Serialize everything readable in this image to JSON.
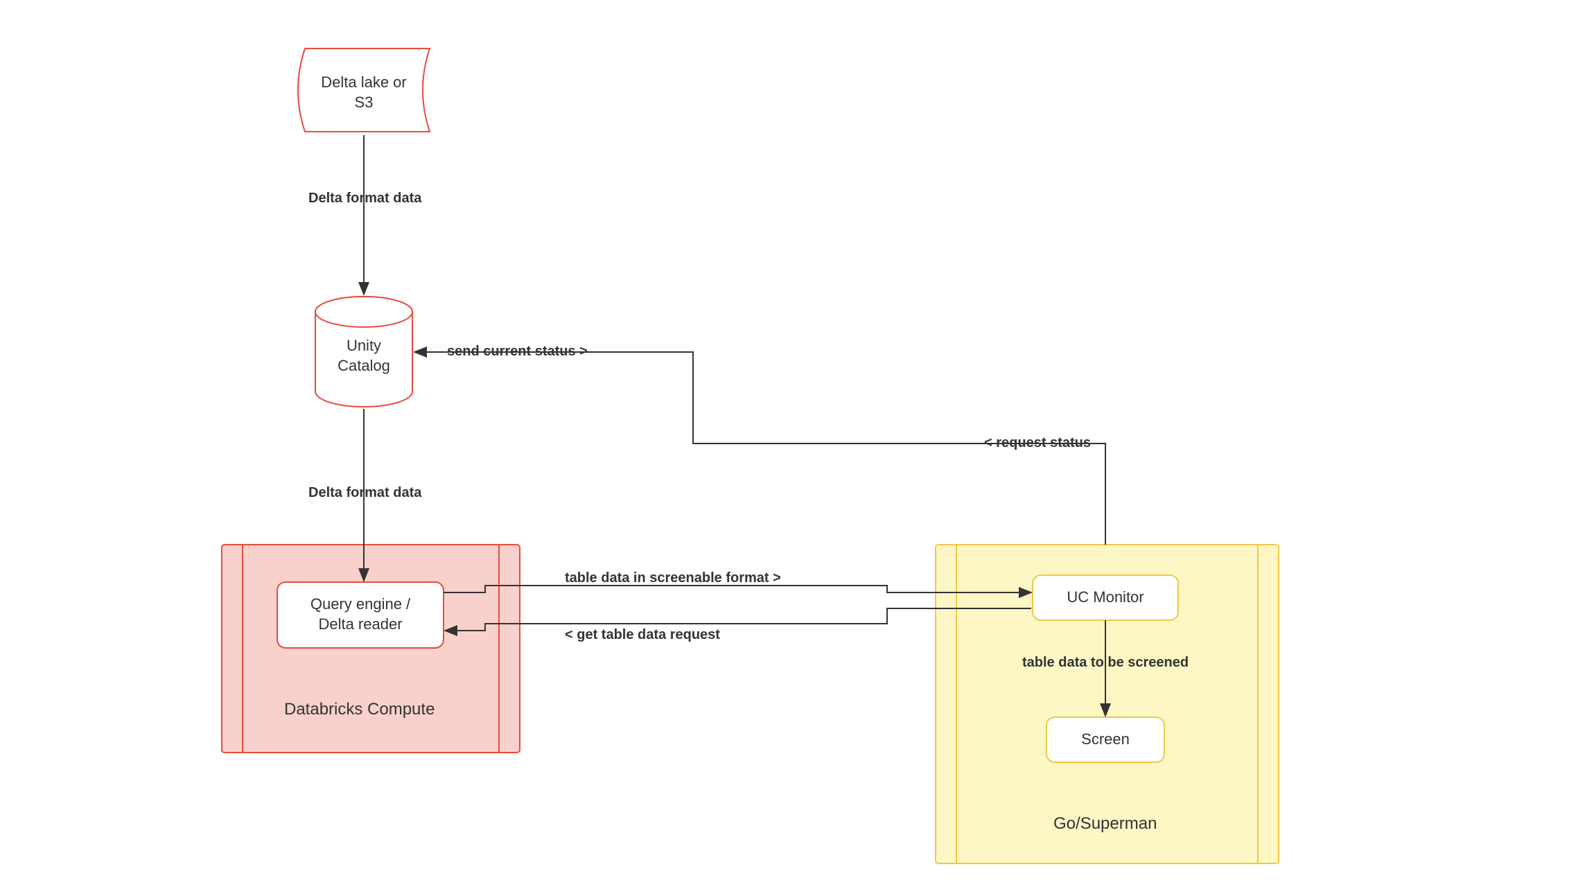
{
  "nodes": {
    "delta_lake": "Delta lake or\nS3",
    "unity_catalog": "Unity\nCatalog",
    "query_engine": "Query engine /\nDelta reader",
    "uc_monitor": "UC Monitor",
    "screen": "Screen"
  },
  "containers": {
    "databricks": "Databricks Compute",
    "go_superman": "Go/Superman"
  },
  "edges": {
    "delta_format_1": "Delta format data",
    "delta_format_2": "Delta format data",
    "send_status": "send current status >",
    "request_status": "< request status",
    "table_data_screenable": "table data in screenable format >",
    "get_table_data": "< get table data request",
    "table_data_screened": "table data to be screened"
  },
  "colors": {
    "red": "#e84c3d",
    "red_fill": "#f8d0cc",
    "yellow": "#f2c744",
    "yellow_fill": "#fdf6c5",
    "arrow": "#333333"
  }
}
